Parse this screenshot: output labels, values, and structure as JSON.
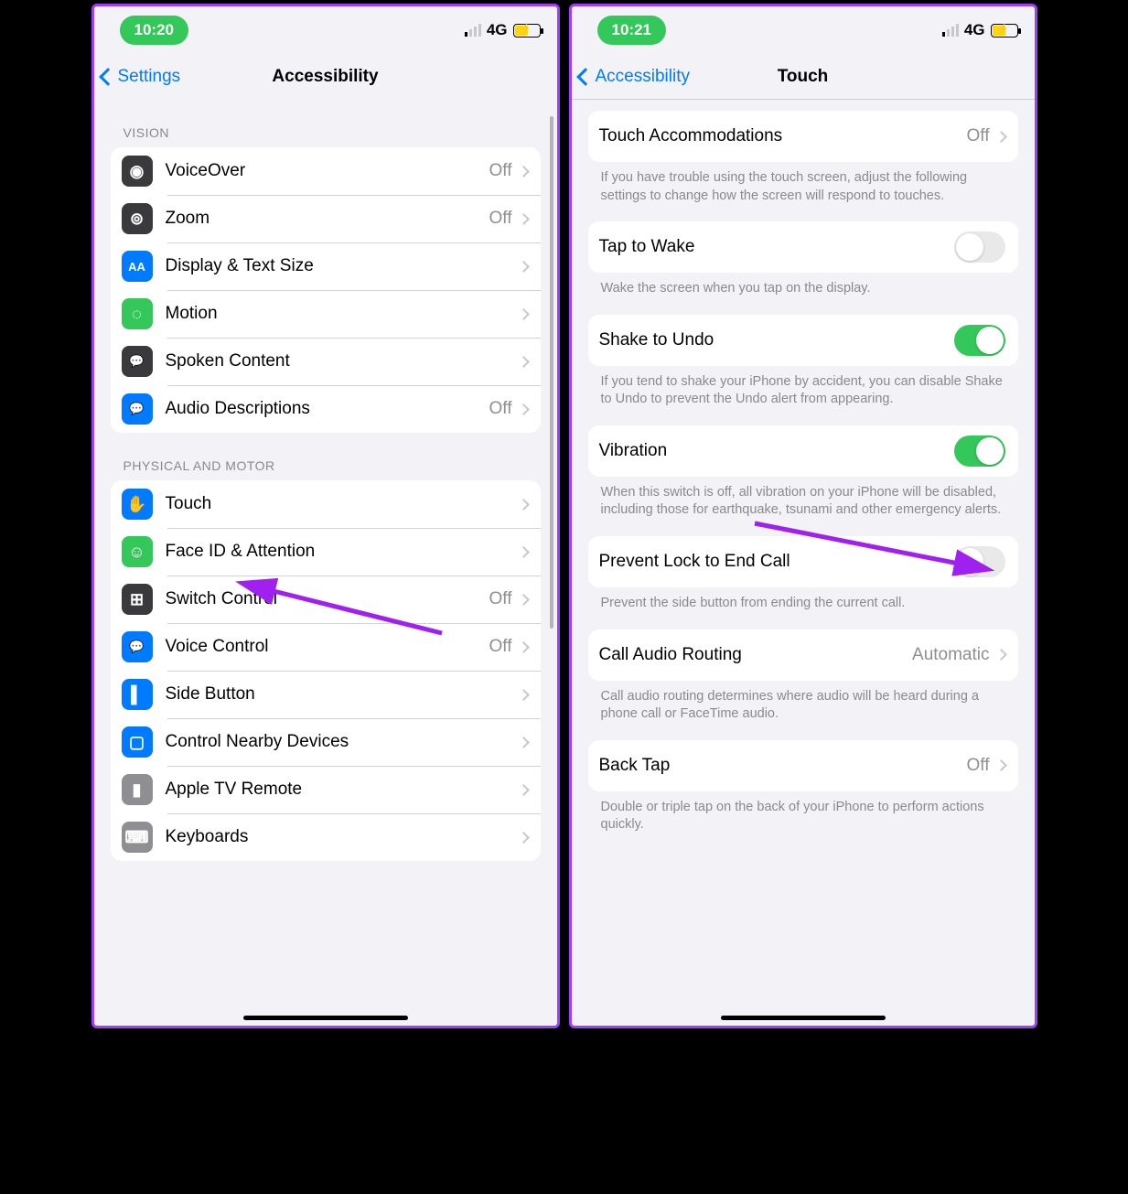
{
  "left": {
    "status": {
      "time": "10:20",
      "network": "4G"
    },
    "nav": {
      "back": "Settings",
      "title": "Accessibility"
    },
    "sections": [
      {
        "header": "VISION",
        "rows": [
          {
            "icon": "voiceover-icon",
            "bg": "#3a3a3c",
            "glyph": "◉",
            "label": "VoiceOver",
            "value": "Off"
          },
          {
            "icon": "zoom-icon",
            "bg": "#3a3a3c",
            "glyph": "⊚",
            "label": "Zoom",
            "value": "Off"
          },
          {
            "icon": "text-size-icon",
            "bg": "#007aff",
            "glyph": "AA",
            "label": "Display & Text Size",
            "value": ""
          },
          {
            "icon": "motion-icon",
            "bg": "#34c759",
            "glyph": "◌",
            "label": "Motion",
            "value": ""
          },
          {
            "icon": "spoken-content-icon",
            "bg": "#3a3a3c",
            "glyph": "💬",
            "label": "Spoken Content",
            "value": ""
          },
          {
            "icon": "audio-desc-icon",
            "bg": "#007aff",
            "glyph": "💬",
            "label": "Audio Descriptions",
            "value": "Off"
          }
        ]
      },
      {
        "header": "PHYSICAL AND MOTOR",
        "rows": [
          {
            "icon": "touch-icon",
            "bg": "#007aff",
            "glyph": "✋",
            "label": "Touch",
            "value": ""
          },
          {
            "icon": "faceid-icon",
            "bg": "#34c759",
            "glyph": "☺",
            "label": "Face ID & Attention",
            "value": ""
          },
          {
            "icon": "switch-control-icon",
            "bg": "#3a3a3c",
            "glyph": "⊞",
            "label": "Switch Control",
            "value": "Off"
          },
          {
            "icon": "voice-control-icon",
            "bg": "#007aff",
            "glyph": "💬",
            "label": "Voice Control",
            "value": "Off"
          },
          {
            "icon": "side-button-icon",
            "bg": "#007aff",
            "glyph": "▌",
            "label": "Side Button",
            "value": ""
          },
          {
            "icon": "nearby-devices-icon",
            "bg": "#007aff",
            "glyph": "▢",
            "label": "Control Nearby Devices",
            "value": ""
          },
          {
            "icon": "apple-tv-icon",
            "bg": "#8e8e93",
            "glyph": "▮",
            "label": "Apple TV Remote",
            "value": ""
          },
          {
            "icon": "keyboard-icon",
            "bg": "#8e8e93",
            "glyph": "⌨",
            "label": "Keyboards",
            "value": ""
          }
        ]
      }
    ]
  },
  "right": {
    "status": {
      "time": "10:21",
      "network": "4G"
    },
    "nav": {
      "back": "Accessibility",
      "title": "Touch"
    },
    "groups": [
      {
        "rows": [
          {
            "label": "Touch Accommodations",
            "value": "Off",
            "chevron": true
          }
        ],
        "footer": "If you have trouble using the touch screen, adjust the following settings to change how the screen will respond to touches."
      },
      {
        "rows": [
          {
            "label": "Tap to Wake",
            "toggle": false
          }
        ],
        "footer": "Wake the screen when you tap on the display."
      },
      {
        "rows": [
          {
            "label": "Shake to Undo",
            "toggle": true
          }
        ],
        "footer": "If you tend to shake your iPhone by accident, you can disable Shake to Undo to prevent the Undo alert from appearing."
      },
      {
        "rows": [
          {
            "label": "Vibration",
            "toggle": true
          }
        ],
        "footer": "When this switch is off, all vibration on your iPhone will be disabled, including those for earthquake, tsunami and other emergency alerts."
      },
      {
        "rows": [
          {
            "label": "Prevent Lock to End Call",
            "toggle": false
          }
        ],
        "footer": "Prevent the side button from ending the current call."
      },
      {
        "rows": [
          {
            "label": "Call Audio Routing",
            "value": "Automatic",
            "chevron": true
          }
        ],
        "footer": "Call audio routing determines where audio will be heard during a phone call or FaceTime audio."
      },
      {
        "rows": [
          {
            "label": "Back Tap",
            "value": "Off",
            "chevron": true
          }
        ],
        "footer": "Double or triple tap on the back of your iPhone to perform actions quickly."
      }
    ]
  }
}
